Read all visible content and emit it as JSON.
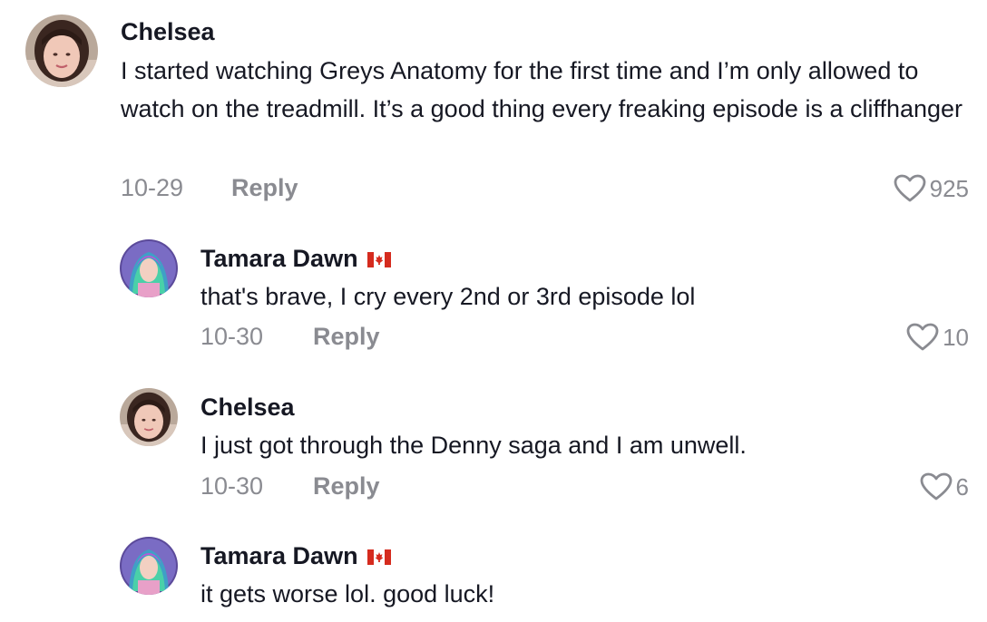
{
  "comments": [
    {
      "username": "Chelsea",
      "text": "I started watching Greys Anatomy for the first time and I’m only allowed to watch on the treadmill. It’s a good thing every freaking episode is a cliffhanger",
      "date": "10-29",
      "reply_label": "Reply",
      "likes": "925",
      "avatar_icon": "user-avatar-brunette",
      "flag": ""
    },
    {
      "username": "Tamara Dawn",
      "text": "that's brave, I cry every 2nd or 3rd episode lol",
      "date": "10-30",
      "reply_label": "Reply",
      "likes": "10",
      "avatar_icon": "user-avatar-colorful-hair",
      "flag": "canada-flag"
    },
    {
      "username": "Chelsea",
      "text": "I just got through the Denny saga and I am unwell.",
      "date": "10-30",
      "reply_label": "Reply",
      "likes": "6",
      "avatar_icon": "user-avatar-brunette",
      "flag": ""
    },
    {
      "username": "Tamara Dawn",
      "text": "it gets worse lol. good luck!",
      "avatar_icon": "user-avatar-colorful-hair",
      "flag": "canada-flag"
    }
  ],
  "colors": {
    "primary_text": "#161823",
    "secondary_text": "#8a8b91",
    "flag_red": "#d52b1e"
  }
}
